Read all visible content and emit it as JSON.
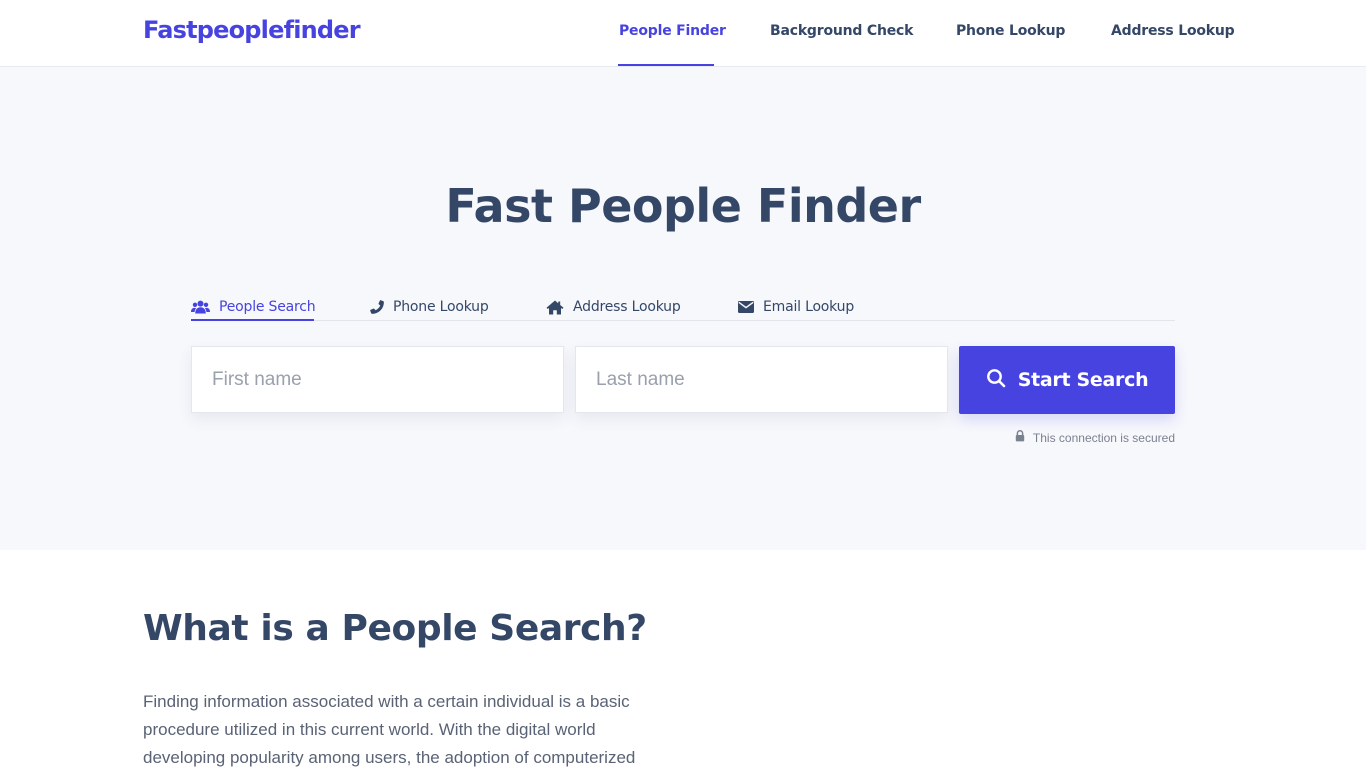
{
  "header": {
    "logo": "Fastpeoplefinder",
    "nav": [
      {
        "label": "People Finder",
        "active": true
      },
      {
        "label": "Background Check",
        "active": false
      },
      {
        "label": "Phone Lookup",
        "active": false
      },
      {
        "label": "Address Lookup",
        "active": false
      }
    ]
  },
  "hero": {
    "title": "Fast People Finder",
    "tabs": [
      {
        "label": "People Search",
        "icon": "users-icon",
        "active": true
      },
      {
        "label": "Phone Lookup",
        "icon": "phone-icon",
        "active": false
      },
      {
        "label": "Address Lookup",
        "icon": "home-icon",
        "active": false
      },
      {
        "label": "Email Lookup",
        "icon": "envelope-icon",
        "active": false
      }
    ],
    "first_name": {
      "value": "",
      "placeholder": "First name"
    },
    "last_name": {
      "value": "",
      "placeholder": "Last name"
    },
    "search_button": {
      "label": "Start Search",
      "icon": "search-icon"
    },
    "secure_note": {
      "label": "This connection is secured",
      "icon": "lock-icon"
    }
  },
  "content": {
    "title": "What is a People Search?",
    "paragraph": "Finding information associated with a certain individual is a basic procedure utilized in this current world. With the digital world developing popularity among users, the adoption of computerized"
  },
  "colors": {
    "accent": "#4743e0",
    "text": "#344767",
    "hero_background": "#f7f8fc"
  }
}
